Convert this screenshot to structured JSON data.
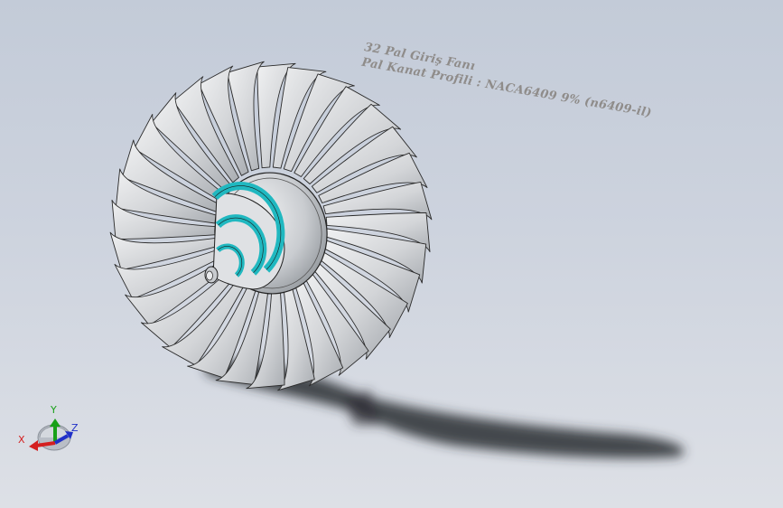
{
  "annotation": {
    "line1": "32 Pal Giriş Fanı",
    "line2": "Pal Kanat Profili : NACA6409 9% (n6409-il)"
  },
  "triad": {
    "x_label": "X",
    "y_label": "Y",
    "z_label": "Z",
    "x_color": "#d42020",
    "y_color": "#18a018",
    "z_color": "#2030c8"
  },
  "model": {
    "blade_count": 32,
    "spinner_accent_color": "#20b8c0",
    "blade_color": "#d6d8da"
  }
}
